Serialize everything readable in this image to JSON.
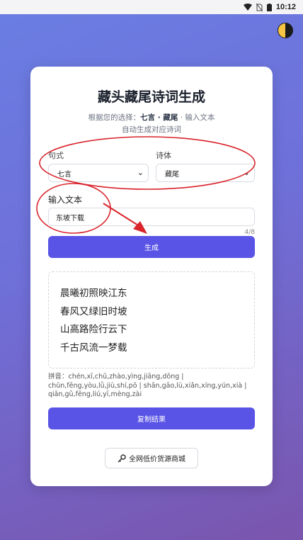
{
  "status": {
    "time": "10:12",
    "icons": [
      "wifi-icon",
      "no-sim-icon",
      "battery-icon"
    ]
  },
  "theme_toggle": {
    "icon": "half-moon-icon"
  },
  "card": {
    "title": "藏头藏尾诗词生成",
    "subtitle_prefix": "根据您的选择：",
    "subtitle_choice": "七言 · 藏尾",
    "subtitle_suffix": " · 输入文本",
    "subtitle_line2": "自动生成对应诗词"
  },
  "form": {
    "form_label": "句式",
    "form_value": "七言",
    "style_label": "诗体",
    "style_value": "藏尾",
    "input_label": "输入文本",
    "input_value": "东坡下载",
    "counter": "4/8",
    "generate_label": "生成"
  },
  "result": {
    "lines": [
      "晨曦初照映江东",
      "春风又绿旧时坡",
      "山高路险行云下",
      "千古风流一梦载"
    ],
    "pinyin": "拼音：chén,xī,chū,zhào,yìng,jiāng,dōng | chūn,fēng,yòu,lǜ,jiù,shí,pō | shān,gāo,lù,xiǎn,xíng,yún,xià | qiān,gǔ,fēng,liú,yī,mèng,zài",
    "copy_label": "复制结果"
  },
  "store": {
    "label": "全网低价货源商城",
    "icon": "key-icon"
  },
  "annotation_color": "#d9242b",
  "colors": {
    "primary": "#5a54e6",
    "bg_start": "#6a7ee3",
    "bg_end": "#7a55ad"
  }
}
